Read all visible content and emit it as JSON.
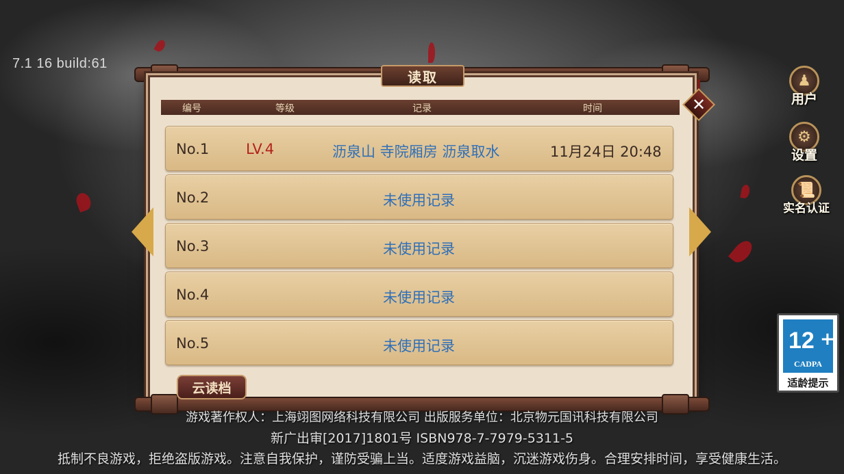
{
  "version_text": "7.1 16 build:61",
  "dialog": {
    "title": "读取",
    "columns": {
      "number": "编号",
      "level": "等级",
      "record": "记录",
      "time": "时间"
    },
    "close_icon": "close-x-icon",
    "slots": [
      {
        "number": "No.1",
        "level": "LV.4",
        "location": "沥泉山 寺院厢房 沥泉取水",
        "time": "11月24日 20:48",
        "empty": ""
      },
      {
        "number": "No.2",
        "level": "",
        "location": "",
        "time": "",
        "empty": "未使用记录"
      },
      {
        "number": "No.3",
        "level": "",
        "location": "",
        "time": "",
        "empty": "未使用记录"
      },
      {
        "number": "No.4",
        "level": "",
        "location": "",
        "time": "",
        "empty": "未使用记录"
      },
      {
        "number": "No.5",
        "level": "",
        "location": "",
        "time": "",
        "empty": "未使用记录"
      }
    ],
    "cloud_button": "云读档"
  },
  "nav": {
    "prev_icon": "arrow-left-icon",
    "next_icon": "arrow-right-icon"
  },
  "side_menu": [
    {
      "label": "用户",
      "icon": "user-icon"
    },
    {
      "label": "设置",
      "icon": "gear-icon"
    },
    {
      "label": "实名认证",
      "icon": "scroll-icon"
    }
  ],
  "age_rating": {
    "number": "12",
    "plus": "+",
    "org": "CADPA",
    "tip": "适龄提示"
  },
  "footer": {
    "line1": "游戏著作权人：上海翊图网络科技有限公司  出版服务单位：北京物元国讯科技有限公司",
    "line2": "新广出审[2017]1801号  ISBN978-7-7979-5311-5",
    "line3": "抵制不良游戏，拒绝盗版游戏。注意自我保护，谨防受骗上当。适度游戏益脑，沉迷游戏伤身。合理安排时间，享受健康生活。"
  },
  "colors": {
    "accent_red": "#b3231b",
    "link_blue": "#2f6fb7",
    "frame_brown": "#4a2a20",
    "paper": "#ece0cd",
    "slot_tan": "#dcbd8a",
    "rating_blue": "#1f7fc1"
  }
}
